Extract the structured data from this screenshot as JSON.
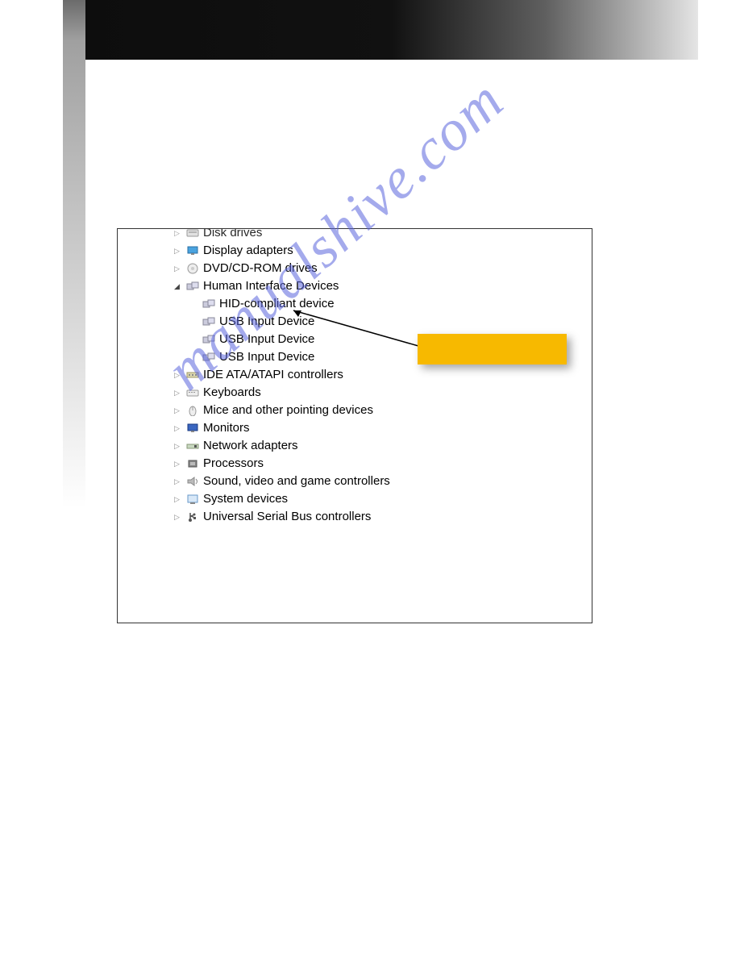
{
  "watermark": "manualshive.com",
  "callout_text": "",
  "tree": {
    "top_partial": "Disk drives",
    "items": [
      {
        "label": "Display adapters",
        "expanded": false,
        "icon": "monitor"
      },
      {
        "label": "DVD/CD-ROM drives",
        "expanded": false,
        "icon": "cd"
      },
      {
        "label": "Human Interface Devices",
        "expanded": true,
        "icon": "hid",
        "children": [
          {
            "label": "HID-compliant device",
            "icon": "hid"
          },
          {
            "label": "USB Input Device",
            "icon": "hid"
          },
          {
            "label": "USB Input Device",
            "icon": "hid"
          },
          {
            "label": "USB Input Device",
            "icon": "hid"
          }
        ]
      },
      {
        "label": "IDE ATA/ATAPI controllers",
        "expanded": false,
        "icon": "ide"
      },
      {
        "label": "Keyboards",
        "expanded": false,
        "icon": "keyboard"
      },
      {
        "label": "Mice and other pointing devices",
        "expanded": false,
        "icon": "mouse"
      },
      {
        "label": "Monitors",
        "expanded": false,
        "icon": "monitor2"
      },
      {
        "label": "Network adapters",
        "expanded": false,
        "icon": "network"
      },
      {
        "label": "Processors",
        "expanded": false,
        "icon": "cpu"
      },
      {
        "label": "Sound, video and game controllers",
        "expanded": false,
        "icon": "sound"
      },
      {
        "label": "System devices",
        "expanded": false,
        "icon": "system"
      },
      {
        "label": "Universal Serial Bus controllers",
        "expanded": false,
        "icon": "usb"
      }
    ]
  }
}
